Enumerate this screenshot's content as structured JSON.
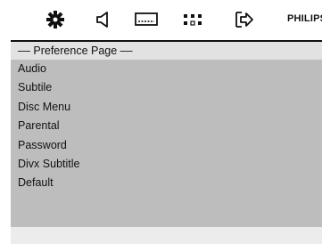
{
  "toolbar": {
    "icons": [
      "gear-icon",
      "speaker-icon",
      "display-icon",
      "grid-icon",
      "exit-arrow-icon"
    ],
    "brand": "PHILIPS"
  },
  "panel": {
    "title": "–– Preference Page ––",
    "items": [
      {
        "label": "Audio"
      },
      {
        "label": "Subtile"
      },
      {
        "label": "Disc Menu"
      },
      {
        "label": "Parental"
      },
      {
        "label": "Password"
      },
      {
        "label": "Divx Subtitle"
      },
      {
        "label": "Default"
      }
    ]
  },
  "colors": {
    "panel_bg": "#bdbdbd",
    "title_bg": "#e2e2e2",
    "footer_bg": "#ececec",
    "text": "#111111"
  }
}
